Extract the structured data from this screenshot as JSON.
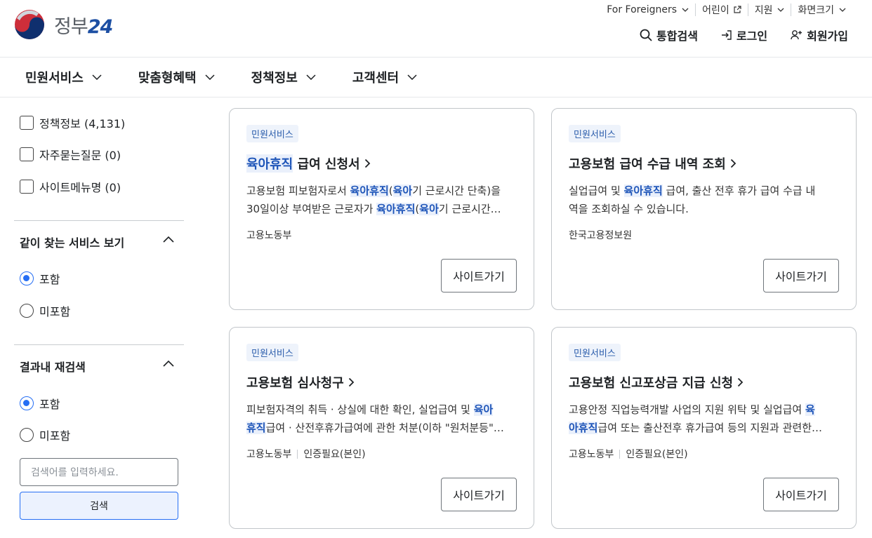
{
  "logo": {
    "text": "정부",
    "num": "24"
  },
  "util": [
    {
      "label": "For Foreigners"
    },
    {
      "label": "어린이"
    },
    {
      "label": "지원"
    },
    {
      "label": "화면크기"
    }
  ],
  "gnb": {
    "search": "통합검색",
    "login": "로그인",
    "signup": "회원가입"
  },
  "nav": [
    "민원서비스",
    "맞춤형혜택",
    "정책정보",
    "고객센터"
  ],
  "sidebar": {
    "checks": [
      "정책정보 (4,131)",
      "자주묻는질문 (0)",
      "사이트메뉴명 (0)"
    ],
    "section1": {
      "title": "같이 찾는 서비스 보기",
      "options": [
        "포함",
        "미포함"
      ],
      "selected": 0
    },
    "section2": {
      "title": "결과내 재검색",
      "options": [
        "포함",
        "미포함"
      ],
      "selected": 0
    },
    "search_placeholder": "검색어를 입력하세요.",
    "search_button": "검색"
  },
  "cards": [
    {
      "badge": "민원서비스",
      "title_hl": "육아휴직",
      "title_rest": " 급여 신청서",
      "line1": [
        "고용보험 피보험자로서 ",
        {
          "h": "육아휴직"
        },
        "(",
        {
          "h": "육아"
        },
        "기 근로시간 단축)을"
      ],
      "line2": [
        "30일이상 부여받은 근로자가 ",
        {
          "h": "육아휴직"
        },
        "(",
        {
          "h": "육아"
        },
        "기 근로시간…"
      ],
      "org": "고용노동부",
      "auth": "",
      "button": "사이트가기"
    },
    {
      "badge": "민원서비스",
      "title_hl": "",
      "title_rest": "고용보험 급여 수급 내역 조회",
      "line1": [
        "실업급여 및 ",
        {
          "h": "육아휴직"
        },
        " 급여, 출산 전후 휴가 급여 수급 내"
      ],
      "line2": [
        "역을 조회하실 수 있습니다."
      ],
      "org": "한국고용정보원",
      "auth": "",
      "button": "사이트가기"
    },
    {
      "badge": "민원서비스",
      "title_hl": "",
      "title_rest": "고용보험 심사청구",
      "line1": [
        "피보험자격의 취득 · 상실에 대한 확인, 실업급여 및 ",
        {
          "h": "육아"
        }
      ],
      "line2": [
        {
          "h": "휴직"
        },
        "급여 · 산전후휴가급여에 관한 처분(이하 \"원처분등\"…"
      ],
      "org": "고용노동부",
      "auth": "인증필요(본인)",
      "button": "사이트가기"
    },
    {
      "badge": "민원서비스",
      "title_hl": "",
      "title_rest": "고용보험 신고포상금 지급 신청",
      "line1": [
        "고용안정 직업능력개발 사업의 지원 위탁 및 실업급여 ",
        {
          "h": "육"
        }
      ],
      "line2": [
        {
          "h": "아휴직"
        },
        "급여 또는 출산전후 휴가급여 등의 지원과 관련한…"
      ],
      "org": "고용노동부",
      "auth": "인증필요(본인)",
      "button": "사이트가기"
    }
  ]
}
